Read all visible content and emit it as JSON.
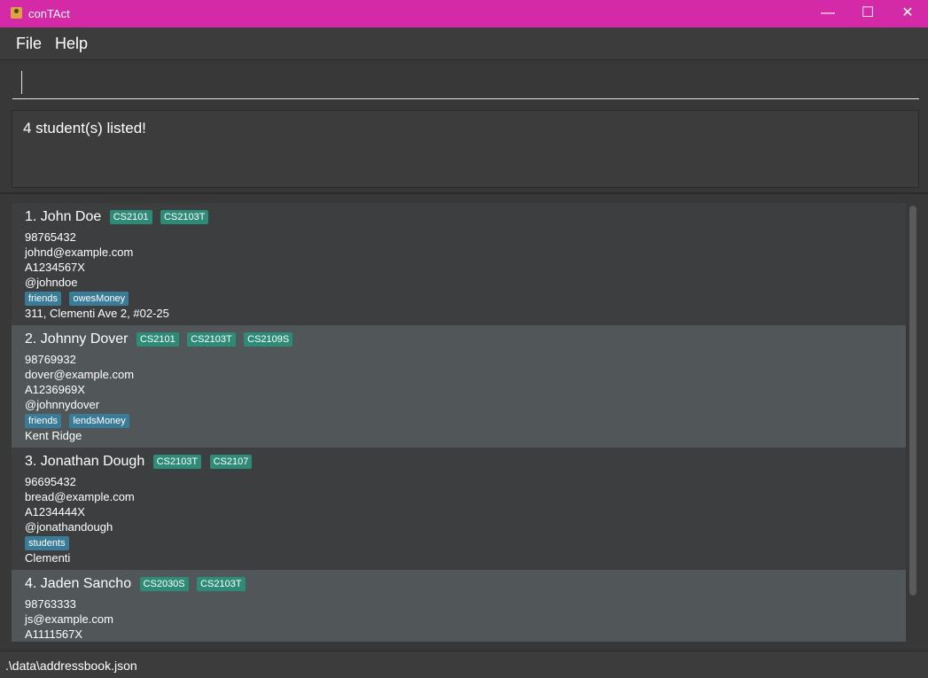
{
  "window": {
    "title": "conTAct",
    "minimize": "—",
    "maximize": "☐",
    "close": "✕"
  },
  "menu": {
    "file": "File",
    "help": "Help"
  },
  "command": {
    "value": ""
  },
  "result": {
    "text": "4 student(s) listed!"
  },
  "students": [
    {
      "name": "1. John Doe",
      "modules": [
        "CS2101",
        "CS2103T"
      ],
      "phone": "98765432",
      "email": "johnd@example.com",
      "matric": "A1234567X",
      "telegram": "@johndoe",
      "tags": [
        "friends",
        "owesMoney"
      ],
      "address": "311, Clementi Ave 2, #02-25"
    },
    {
      "name": "2. Johnny Dover",
      "modules": [
        "CS2101",
        "CS2103T",
        "CS2109S"
      ],
      "phone": "98769932",
      "email": "dover@example.com",
      "matric": "A1236969X",
      "telegram": "@johnnydover",
      "tags": [
        "friends",
        "lendsMoney"
      ],
      "address": "Kent Ridge"
    },
    {
      "name": "3. Jonathan Dough",
      "modules": [
        "CS2103T",
        "CS2107"
      ],
      "phone": "96695432",
      "email": "bread@example.com",
      "matric": "A1234444X",
      "telegram": "@jonathandough",
      "tags": [
        "students"
      ],
      "address": "Clementi"
    },
    {
      "name": "4. Jaden Sancho",
      "modules": [
        "CS2030S",
        "CS2103T"
      ],
      "phone": "98763333",
      "email": "js@example.com",
      "matric": "A1111567X",
      "telegram": "",
      "tags": [],
      "address": ""
    }
  ],
  "status": {
    "path": ".\\data\\addressbook.json"
  }
}
